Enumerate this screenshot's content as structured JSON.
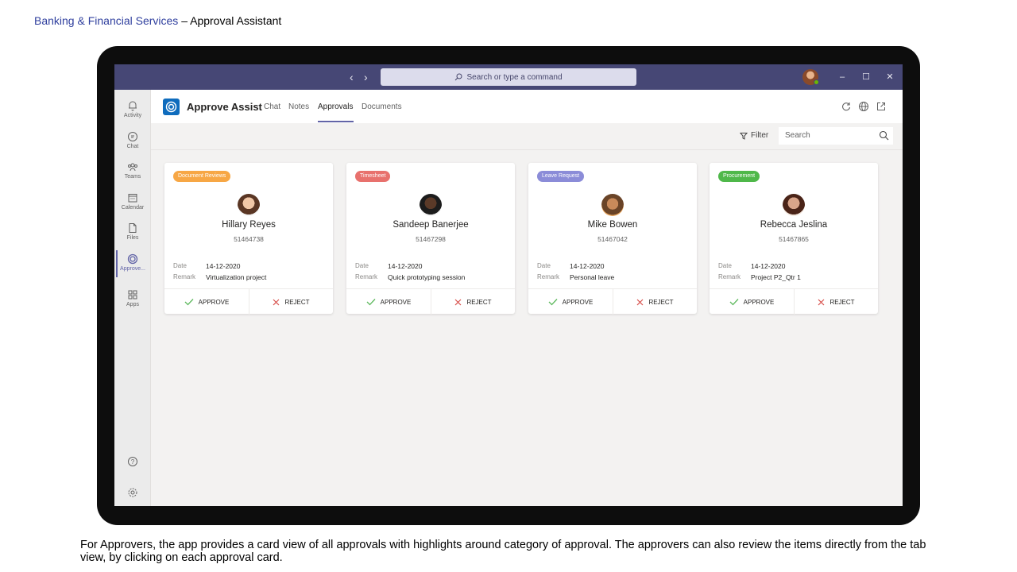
{
  "slide": {
    "title_accent": "Banking & Financial Services",
    "title_rest": " – Approval Assistant",
    "caption": "For Approvers, the app provides a card view of all approvals with highlights around category of approval. The approvers can also review the items directly from the tab view, by clicking on each approval card."
  },
  "titlebar": {
    "back_icon": "chevron-left-icon",
    "forward_icon": "chevron-right-icon",
    "search_placeholder": "Search or type a command",
    "minimize": "–",
    "maximize": "☐",
    "close": "✕"
  },
  "rail": {
    "items": [
      {
        "label": "Activity",
        "icon": "bell-icon"
      },
      {
        "label": "Chat",
        "icon": "chat-icon"
      },
      {
        "label": "Teams",
        "icon": "teams-icon"
      },
      {
        "label": "Calendar",
        "icon": "calendar-icon"
      },
      {
        "label": "Files",
        "icon": "file-icon"
      },
      {
        "label": "Approve...",
        "icon": "approve-assist-icon",
        "active": true
      },
      {
        "label": "Apps",
        "icon": "apps-icon"
      }
    ],
    "help_icon": "help-icon",
    "settings_icon": "gear-icon"
  },
  "app": {
    "name": "Approve Assist",
    "tabs": [
      "Chat",
      "Notes",
      "Approvals",
      "Documents"
    ],
    "active_tab": "Approvals"
  },
  "toolbar": {
    "filter_label": "Filter",
    "search_placeholder": "Search"
  },
  "cards": [
    {
      "category": "Document Reviews",
      "category_color": "#f7a745",
      "name": "Hillary Reyes",
      "id": "51464738",
      "date_label": "Date",
      "date": "14-12-2020",
      "remark_label": "Remark",
      "remark": "Virtualization project",
      "approve": "APPROVE",
      "reject": "REJECT"
    },
    {
      "category": "Timesheet",
      "category_color": "#e8716d",
      "name": "Sandeep Banerjee",
      "id": "51467298",
      "date_label": "Date",
      "date": "14-12-2020",
      "remark_label": "Remark",
      "remark": "Quick prototyping session",
      "approve": "APPROVE",
      "reject": "REJECT"
    },
    {
      "category": "Leave Request",
      "category_color": "#8b8cd8",
      "name": "Mike Bowen",
      "id": "51467042",
      "date_label": "Date",
      "date": "14-12-2020",
      "remark_label": "Remark",
      "remark": "Personal leave",
      "approve": "APPROVE",
      "reject": "REJECT"
    },
    {
      "category": "Procurement",
      "category_color": "#4fb84a",
      "name": "Rebecca Jeslina",
      "id": "51467865",
      "date_label": "Date",
      "date": "14-12-2020",
      "remark_label": "Remark",
      "remark": "Project P2_Qtr 1",
      "approve": "APPROVE",
      "reject": "REJECT"
    }
  ],
  "colors": {
    "titlebar": "#464775",
    "accent": "#6264a7",
    "approve": "#5cb85c",
    "reject": "#d9534f"
  }
}
